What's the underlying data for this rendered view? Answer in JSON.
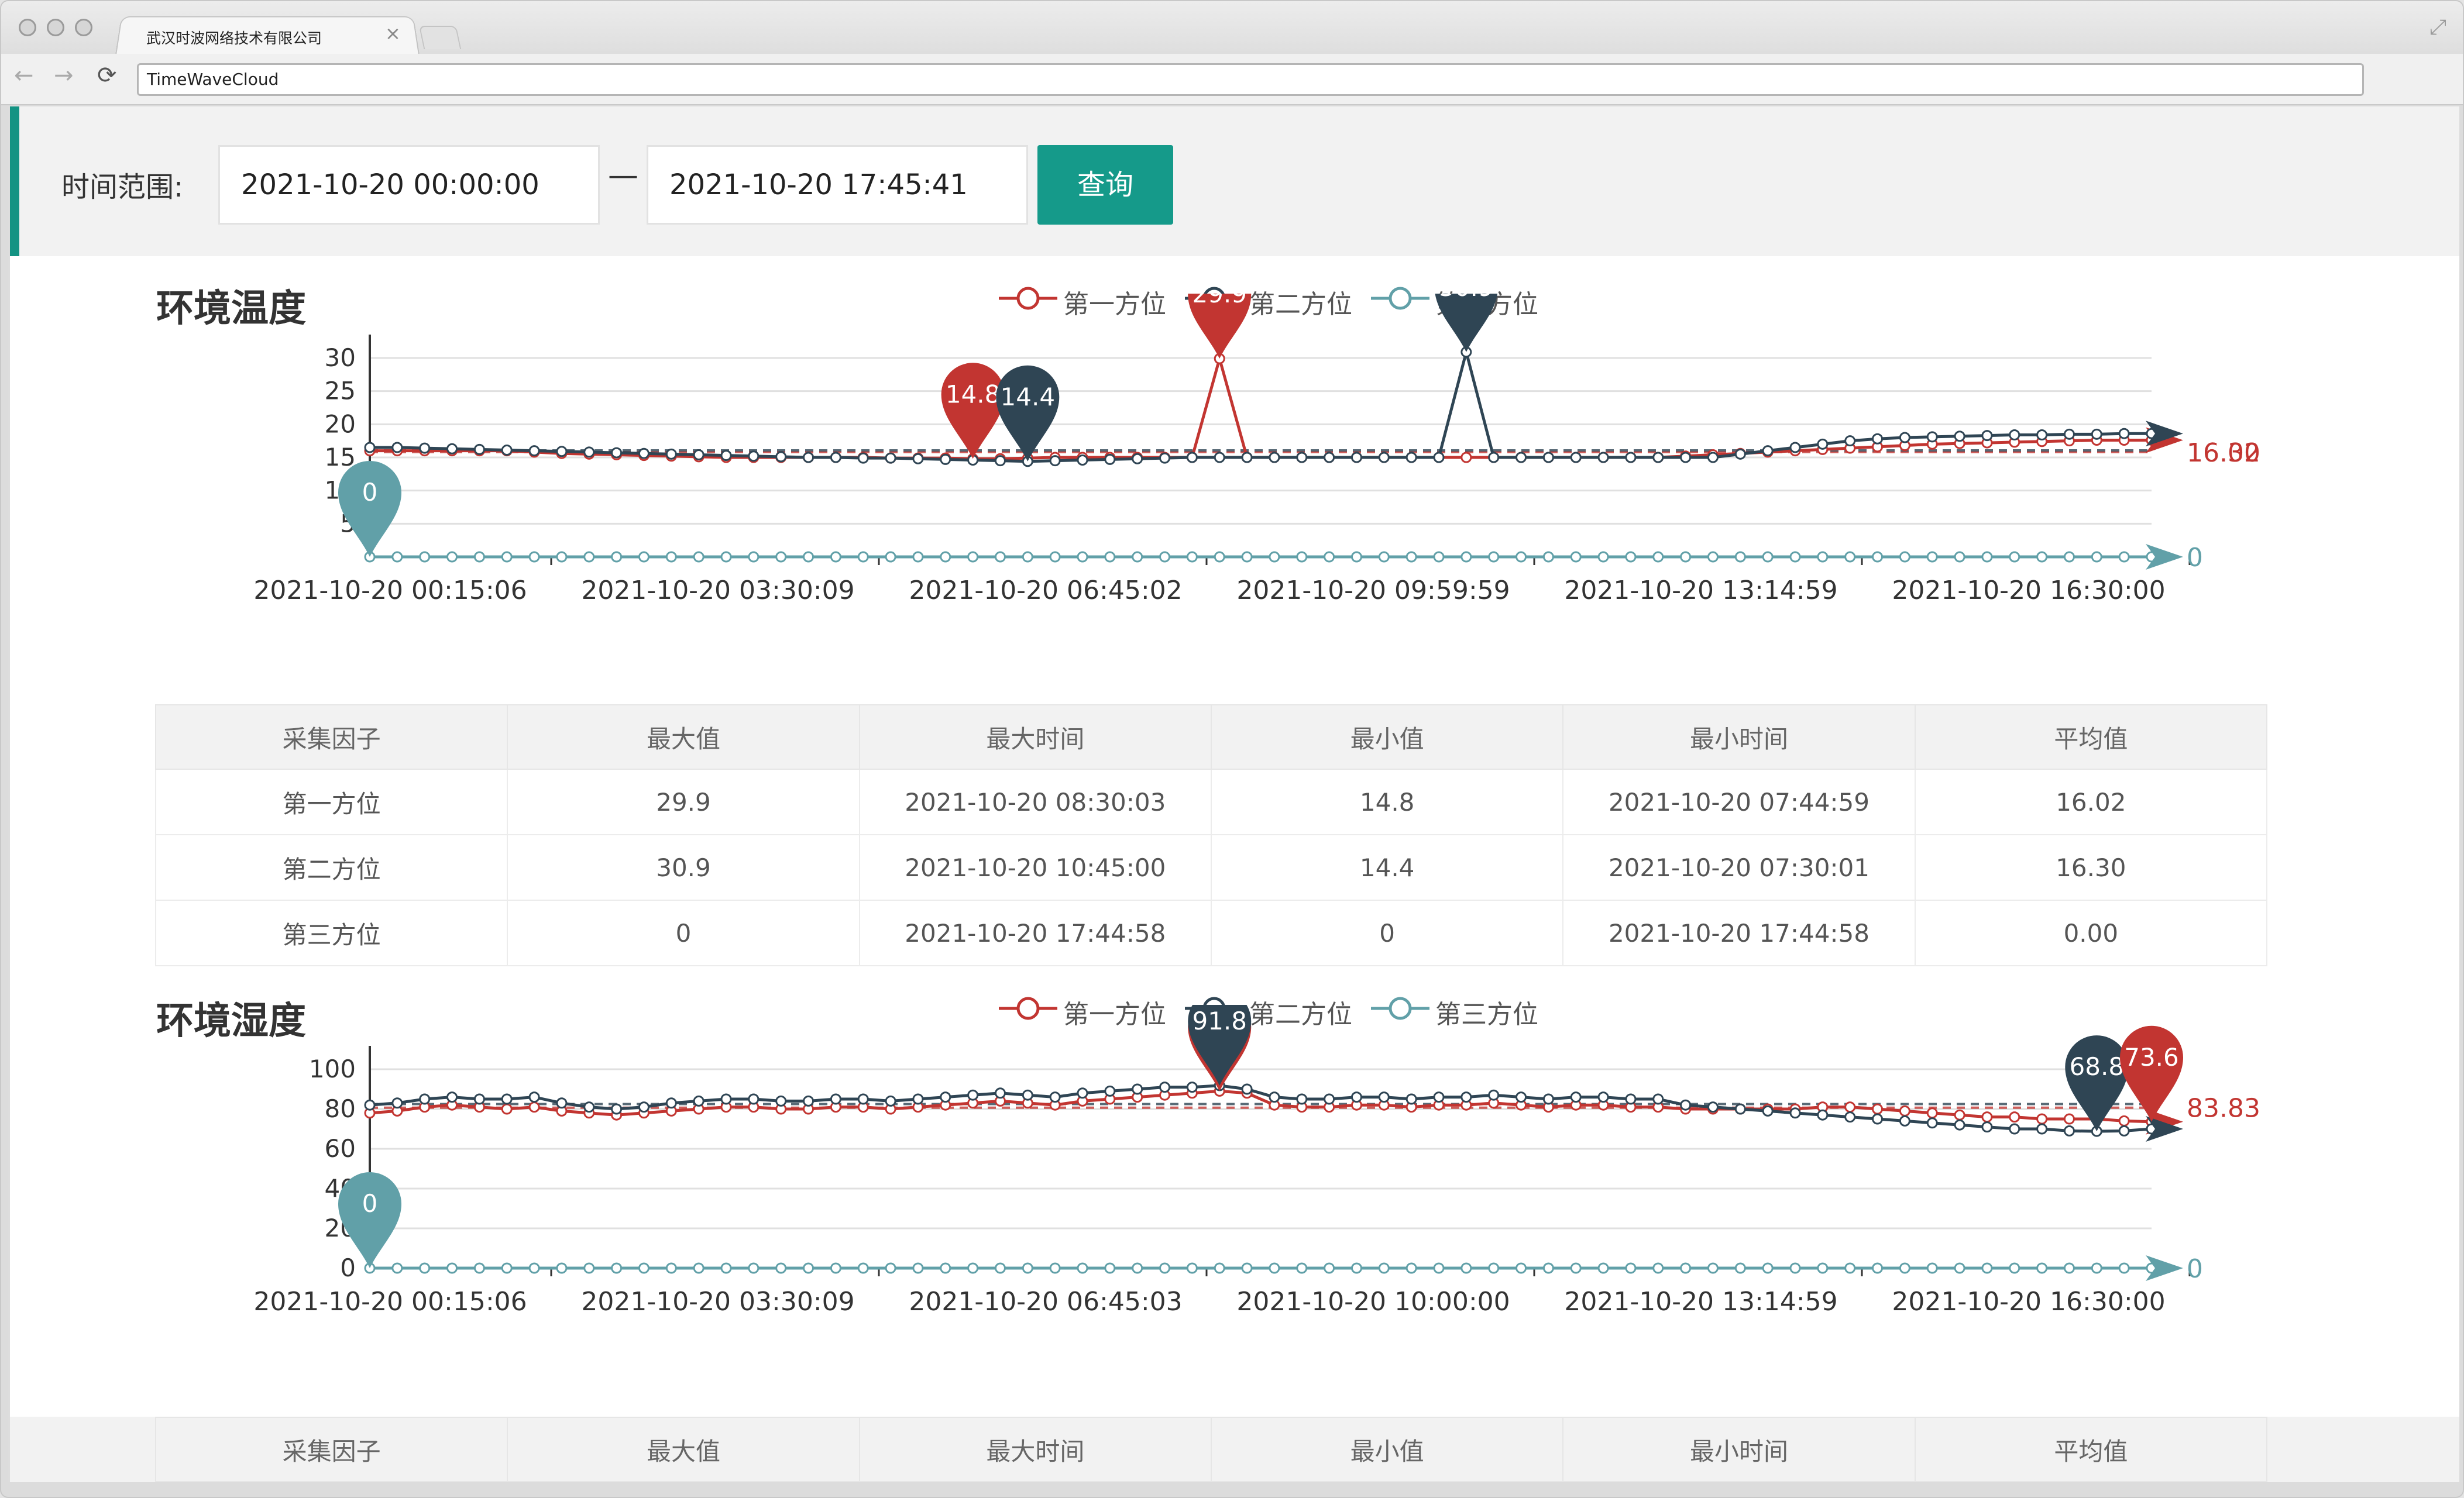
{
  "browser": {
    "tab_title": "武汉时波网络技术有限公司",
    "tab_close": "×",
    "url": "TimeWaveCloud",
    "back_glyph": "←",
    "forward_glyph": "→",
    "reload_glyph": "⟳",
    "resize_glyph": "⤢",
    "icons": [
      "close-icon",
      "back-arrow-icon",
      "forward-arrow-icon",
      "reload-icon",
      "resize-icon"
    ]
  },
  "filter": {
    "label": "时间范围:",
    "start": "2021-10-20 00:00:00",
    "separator": "—",
    "end": "2021-10-20 17:45:41",
    "query_label": "查询",
    "accent": "#159a8a"
  },
  "series_colors": [
    "#c23531",
    "#2f4554",
    "#61a0a8"
  ],
  "temperature": {
    "title": "环境温度",
    "legend": [
      "第一方位",
      "第二方位",
      "第三方位"
    ],
    "chart_data": {
      "type": "line",
      "title": "环境温度",
      "x_tick_labels": [
        "2021-10-20 00:15:06",
        "2021-10-20 03:30:09",
        "2021-10-20 06:45:02",
        "2021-10-20 09:59:59",
        "2021-10-20 13:14:59",
        "2021-10-20 16:30:00"
      ],
      "y_ticks": [
        "5",
        "10",
        "15",
        "20",
        "25",
        "30"
      ],
      "ylim": [
        0,
        30
      ],
      "grid": true,
      "legend_position": "top-center",
      "series": [
        {
          "name": "第一方位",
          "values": [
            16,
            16,
            16,
            16,
            16,
            16,
            15.8,
            15.6,
            15.5,
            15.4,
            15.3,
            15.2,
            15.1,
            15,
            15,
            15,
            15,
            15,
            15,
            14.9,
            14.9,
            14.9,
            14.8,
            14.8,
            14.9,
            15,
            15,
            15,
            15,
            15,
            15,
            29.9,
            15,
            15,
            15,
            15,
            15,
            15,
            15,
            15,
            15,
            15,
            15,
            15,
            15,
            15,
            15,
            15,
            15.2,
            15.4,
            15.6,
            15.8,
            16,
            16.2,
            16.4,
            16.6,
            16.8,
            17,
            17.1,
            17.2,
            17.3,
            17.4,
            17.5,
            17.6,
            17.6,
            17.6
          ]
        },
        {
          "name": "第二方位",
          "values": [
            16.5,
            16.5,
            16.4,
            16.3,
            16.2,
            16.1,
            16,
            15.9,
            15.8,
            15.7,
            15.6,
            15.5,
            15.4,
            15.3,
            15.2,
            15.1,
            15,
            15,
            14.9,
            14.9,
            14.8,
            14.7,
            14.6,
            14.5,
            14.4,
            14.5,
            14.6,
            14.7,
            14.8,
            14.9,
            15,
            15,
            15,
            15,
            15,
            15,
            15,
            15,
            15,
            15,
            30.9,
            15,
            15,
            15,
            15,
            15,
            15,
            15,
            15,
            15,
            15.5,
            16,
            16.5,
            17,
            17.5,
            17.8,
            18,
            18.1,
            18.2,
            18.3,
            18.4,
            18.4,
            18.5,
            18.5,
            18.6,
            18.6
          ]
        },
        {
          "name": "第三方位",
          "values": [
            0,
            0,
            0,
            0,
            0,
            0,
            0,
            0,
            0,
            0,
            0,
            0,
            0,
            0,
            0,
            0,
            0,
            0,
            0,
            0,
            0,
            0,
            0,
            0,
            0,
            0,
            0,
            0,
            0,
            0,
            0,
            0,
            0,
            0,
            0,
            0,
            0,
            0,
            0,
            0,
            0,
            0,
            0,
            0,
            0,
            0,
            0,
            0,
            0,
            0,
            0,
            0,
            0,
            0,
            0,
            0,
            0,
            0,
            0,
            0,
            0,
            0,
            0,
            0,
            0,
            0
          ]
        }
      ],
      "markers": [
        {
          "series": 0,
          "index": 31,
          "label": "29.9"
        },
        {
          "series": 0,
          "index": 22,
          "label": "14.8"
        },
        {
          "series": 1,
          "index": 40,
          "label": "30.9"
        },
        {
          "series": 1,
          "index": 24,
          "label": "14.4"
        },
        {
          "series": 2,
          "index": 0,
          "label": "0"
        }
      ],
      "avg_labels": [
        "16.02",
        "16.30",
        "0"
      ]
    },
    "table": {
      "headers": [
        "采集因子",
        "最大值",
        "最大时间",
        "最小值",
        "最小时间",
        "平均值"
      ],
      "rows": [
        [
          "第一方位",
          "29.9",
          "2021-10-20 08:30:03",
          "14.8",
          "2021-10-20 07:44:59",
          "16.02"
        ],
        [
          "第二方位",
          "30.9",
          "2021-10-20 10:45:00",
          "14.4",
          "2021-10-20 07:30:01",
          "16.30"
        ],
        [
          "第三方位",
          "0",
          "2021-10-20 17:44:58",
          "0",
          "2021-10-20 17:44:58",
          "0.00"
        ]
      ]
    }
  },
  "humidity": {
    "title": "环境湿度",
    "legend": [
      "第一方位",
      "第二方位",
      "第三方位"
    ],
    "chart_data": {
      "type": "line",
      "title": "环境湿度",
      "x_tick_labels": [
        "2021-10-20 00:15:06",
        "2021-10-20 03:30:09",
        "2021-10-20 06:45:03",
        "2021-10-20 10:00:00",
        "2021-10-20 13:14:59",
        "2021-10-20 16:30:00"
      ],
      "y_ticks": [
        "0",
        "20",
        "40",
        "60",
        "80",
        "100"
      ],
      "ylim": [
        0,
        100
      ],
      "grid": true,
      "legend_position": "top-center",
      "series": [
        {
          "name": "第一方位",
          "values": [
            78,
            79,
            81,
            82,
            81,
            80,
            81,
            79,
            78,
            77,
            78,
            79,
            80,
            81,
            81,
            80,
            80,
            81,
            81,
            80,
            81,
            82,
            83,
            84,
            83,
            82,
            84,
            85,
            86,
            87,
            88,
            89,
            88,
            82,
            81,
            81,
            82,
            82,
            81,
            82,
            82,
            83,
            82,
            81,
            82,
            82,
            81,
            81,
            80,
            80,
            80,
            80,
            80,
            81,
            81,
            80,
            79,
            78,
            77,
            76,
            76,
            75,
            75,
            75,
            74,
            73.6
          ]
        },
        {
          "name": "第二方位",
          "values": [
            82,
            83,
            85,
            86,
            85,
            85,
            86,
            83,
            81,
            80,
            81,
            83,
            84,
            85,
            85,
            84,
            84,
            85,
            85,
            84,
            85,
            86,
            87,
            88,
            87,
            86,
            88,
            89,
            90,
            91,
            91,
            91.8,
            90,
            86,
            85,
            85,
            86,
            86,
            85,
            86,
            86,
            87,
            86,
            85,
            86,
            86,
            85,
            85,
            82,
            81,
            80,
            79,
            78,
            77,
            76,
            75,
            74,
            73,
            72,
            71,
            70,
            70,
            69,
            68.8,
            69,
            70
          ]
        },
        {
          "name": "第三方位",
          "values": [
            0,
            0,
            0,
            0,
            0,
            0,
            0,
            0,
            0,
            0,
            0,
            0,
            0,
            0,
            0,
            0,
            0,
            0,
            0,
            0,
            0,
            0,
            0,
            0,
            0,
            0,
            0,
            0,
            0,
            0,
            0,
            0,
            0,
            0,
            0,
            0,
            0,
            0,
            0,
            0,
            0,
            0,
            0,
            0,
            0,
            0,
            0,
            0,
            0,
            0,
            0,
            0,
            0,
            0,
            0,
            0,
            0,
            0,
            0,
            0,
            0,
            0,
            0,
            0,
            0,
            0
          ]
        }
      ],
      "markers": [
        {
          "series": 0,
          "index": 31,
          "label": ""
        },
        {
          "series": 1,
          "index": 31,
          "label": "91.8"
        },
        {
          "series": 1,
          "index": 63,
          "label": "68.8"
        },
        {
          "series": 0,
          "index": 65,
          "label": "73.6"
        },
        {
          "series": 2,
          "index": 0,
          "label": "0"
        }
      ],
      "avg_labels": [
        "83.83",
        "0"
      ]
    },
    "table": {
      "headers": [
        "采集因子",
        "最大值",
        "最大时间",
        "最小值",
        "最小时间",
        "平均值"
      ]
    }
  }
}
